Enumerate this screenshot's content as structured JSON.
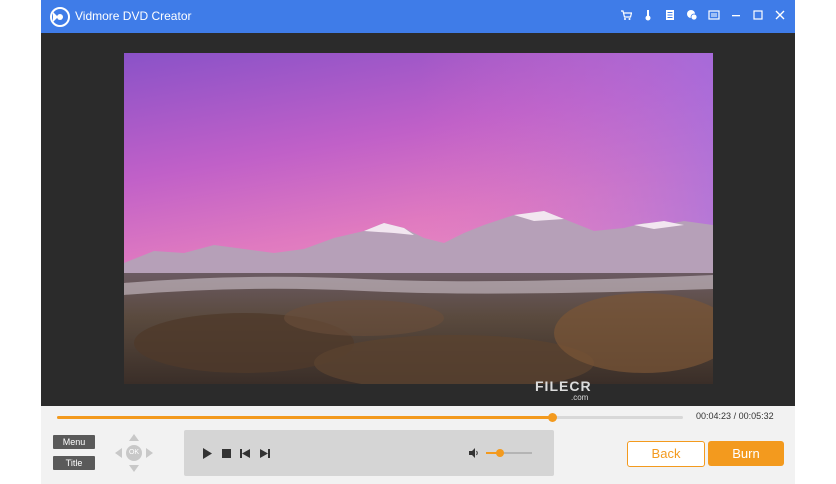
{
  "window": {
    "title": "Vidmore DVD Creator",
    "toolbar_icons": [
      "cart-icon",
      "key-icon",
      "document-icon",
      "chat-icon",
      "menu-icon",
      "minimize-icon",
      "maximize-icon",
      "close-icon"
    ]
  },
  "colors": {
    "titlebar": "#3f7ce8",
    "accent": "#f39a1e",
    "background": "#2b2b2b",
    "control_bar": "#f2f2f2"
  },
  "watermark": {
    "text": "FILECR",
    "sub": ".com"
  },
  "player": {
    "progress_fraction": 0.79,
    "current_time": "00:04:23",
    "total_time": "00:05:32",
    "time_separator": "/",
    "volume_fraction": 0.3,
    "controls": [
      "play-icon",
      "stop-icon",
      "previous-icon",
      "next-icon",
      "volume-icon"
    ]
  },
  "navigation": {
    "menu_label": "Menu",
    "title_label": "Title",
    "ok_label": "OK"
  },
  "actions": {
    "back_label": "Back",
    "burn_label": "Burn"
  }
}
